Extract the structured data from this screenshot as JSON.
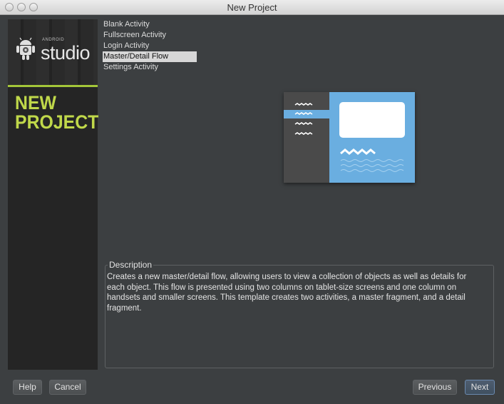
{
  "window": {
    "title": "New Project"
  },
  "sidebar": {
    "logo_small": "ANDROID",
    "logo_big": "studio",
    "heading_line1": "NEW",
    "heading_line2": "PROJECT"
  },
  "templates": [
    {
      "label": "Blank Activity",
      "selected": false
    },
    {
      "label": "Fullscreen Activity",
      "selected": false
    },
    {
      "label": "Login Activity",
      "selected": false
    },
    {
      "label": "Master/Detail Flow",
      "selected": true
    },
    {
      "label": "Settings Activity",
      "selected": false
    }
  ],
  "description": {
    "heading": "Description",
    "text": "Creates a new master/detail flow, allowing users to view a collection of objects as well as details for each object. This flow is presented using two columns on tablet-size screens and one column on handsets and smaller screens. This template creates two activities, a master fragment, and a detail fragment."
  },
  "buttons": {
    "help": "Help",
    "cancel": "Cancel",
    "previous": "Previous",
    "next": "Next"
  },
  "colors": {
    "background": "#3c3f41",
    "sidebar": "#252525",
    "accent_green": "#a4c639",
    "preview_blue": "#6aaee0",
    "preview_dark": "#4a4a4a"
  },
  "icons": [
    "android-robot-icon",
    "master-detail-preview-icon"
  ]
}
